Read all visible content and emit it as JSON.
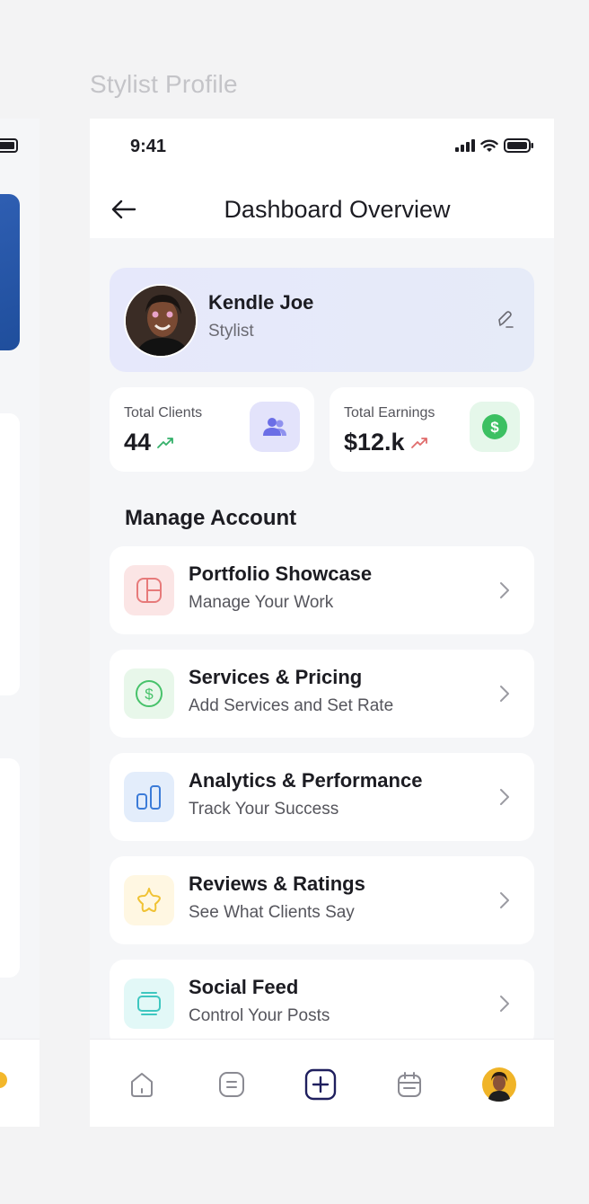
{
  "frame_title": "Stylist Profile",
  "status_bar": {
    "time": "9:41"
  },
  "header": {
    "title": "Dashboard Overview"
  },
  "profile": {
    "name": "Kendle Joe",
    "role": "Stylist"
  },
  "stats": [
    {
      "label": "Total Clients",
      "value": "44",
      "trend": "up",
      "trend_color": "#34b06a",
      "icon": "users-icon",
      "icon_bg": "#e3e3fb",
      "icon_color": "#6b6ee6"
    },
    {
      "label": "Total Earnings",
      "value": "$12.k",
      "trend": "down",
      "trend_color": "#e06b6b",
      "icon": "dollar-icon",
      "icon_bg": "#e5f7ea",
      "icon_color": "#3cc062"
    }
  ],
  "section": {
    "title": "Manage Account"
  },
  "menu": [
    {
      "title": "Portfolio Showcase",
      "subtitle": "Manage Your Work",
      "icon": "layout-icon",
      "icon_bg": "#fbe5e5",
      "icon_color": "#e77a7a"
    },
    {
      "title": "Services & Pricing",
      "subtitle": "Add Services and Set Rate",
      "icon": "dollar-circle-icon",
      "icon_bg": "#e8f7ea",
      "icon_color": "#47c26a"
    },
    {
      "title": "Analytics & Performance",
      "subtitle": "Track Your Success",
      "icon": "bar-chart-icon",
      "icon_bg": "#e3edfb",
      "icon_color": "#3b7bd8"
    },
    {
      "title": "Reviews & Ratings",
      "subtitle": "See What Clients Say",
      "icon": "star-icon",
      "icon_bg": "#fff7e2",
      "icon_color": "#f0c233"
    },
    {
      "title": "Social Feed",
      "subtitle": "Control Your Posts",
      "icon": "feed-icon",
      "icon_bg": "#e2f8f7",
      "icon_color": "#3ec7c0"
    }
  ],
  "bottom_nav": [
    {
      "name": "home",
      "icon": "home-icon"
    },
    {
      "name": "list",
      "icon": "list-icon"
    },
    {
      "name": "add",
      "icon": "add-icon"
    },
    {
      "name": "calendar",
      "icon": "calendar-icon"
    },
    {
      "name": "profile",
      "icon": "avatar"
    }
  ]
}
